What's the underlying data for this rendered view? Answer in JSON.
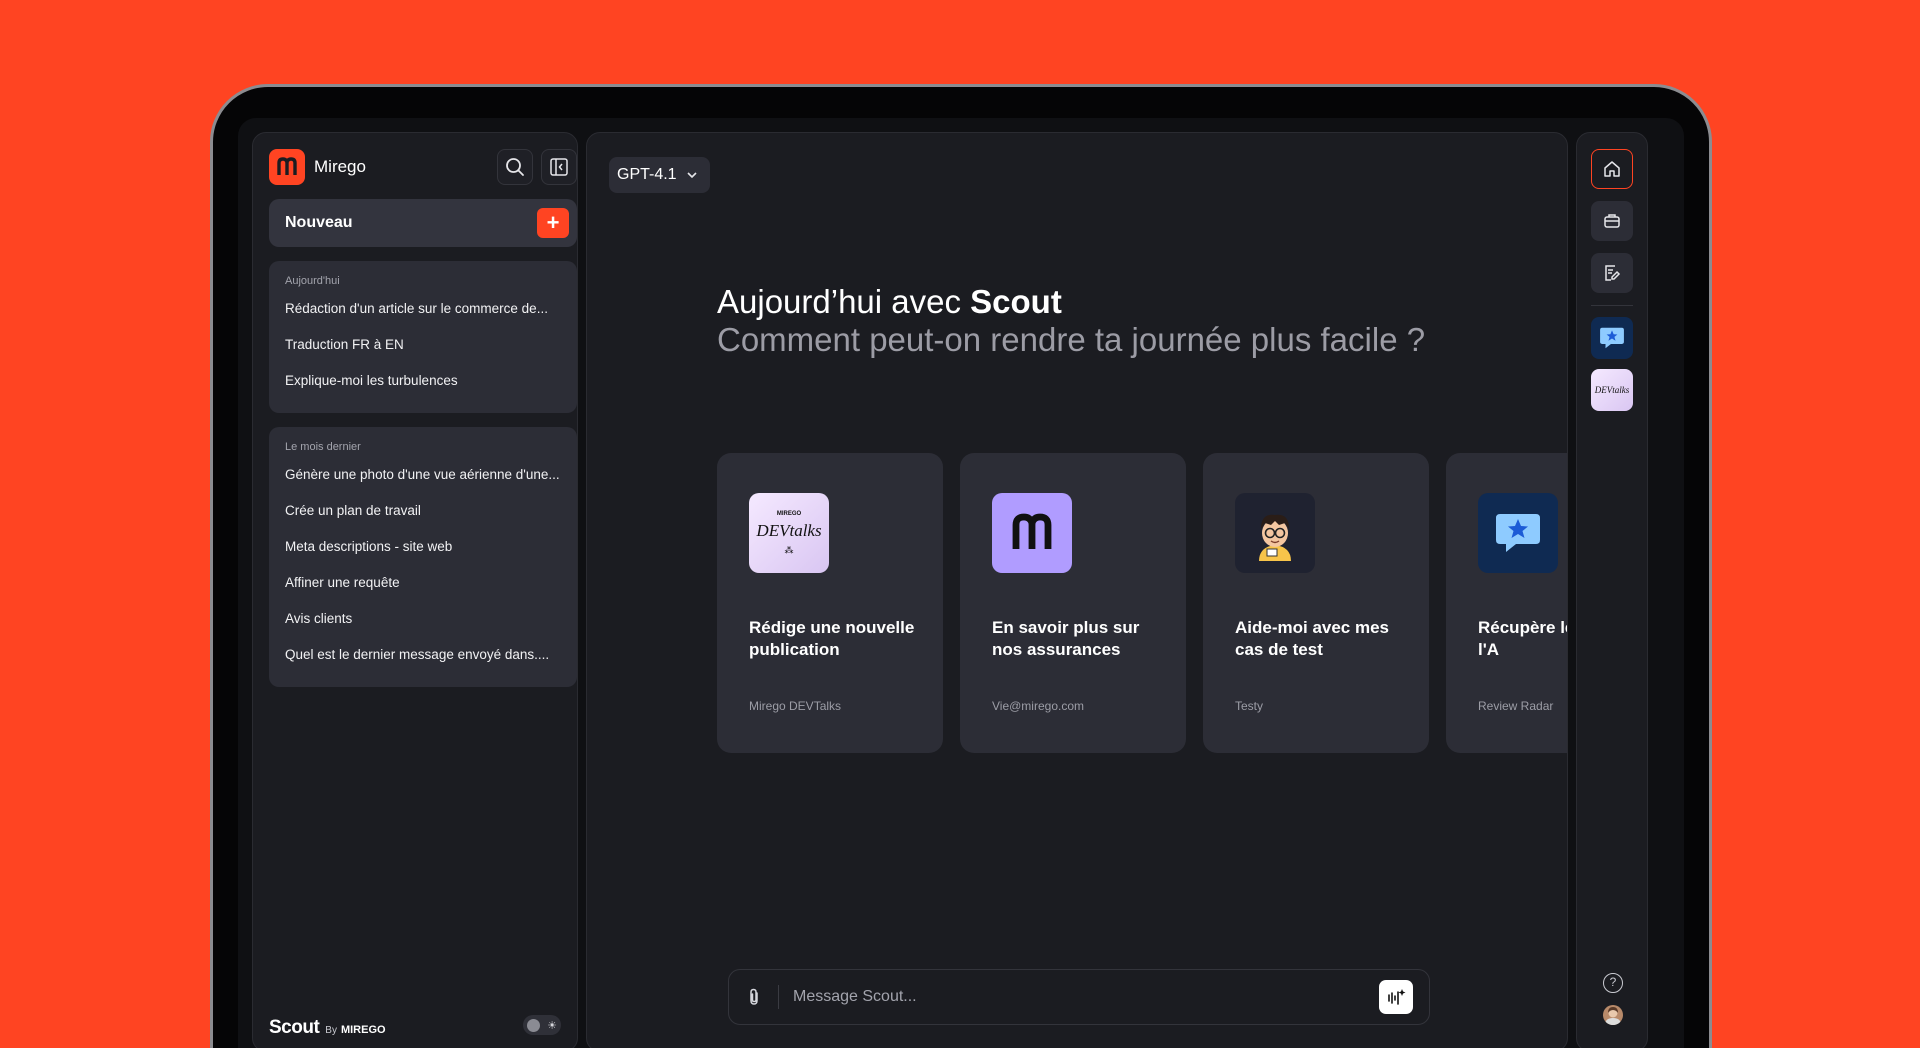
{
  "sidebar": {
    "org_name": "Mirego",
    "new_label": "Nouveau",
    "groups": [
      {
        "title": "Aujourd'hui",
        "items": [
          "Rédaction d'un article sur le commerce de...",
          "Traduction FR à EN",
          "Explique-moi les turbulences"
        ]
      },
      {
        "title": "Le mois dernier",
        "items": [
          "Génère une photo d'une vue aérienne d'une...",
          "Crée un plan de travail",
          "Meta descriptions - site web",
          "Affiner une requête",
          "Avis clients",
          "Quel est le dernier message envoyé dans...."
        ]
      }
    ],
    "footer": {
      "brand": "Scout",
      "by": "By",
      "company": "MIREGO"
    }
  },
  "main": {
    "model": "GPT-4.1",
    "greeting_prefix": "Aujourd’hui avec ",
    "greeting_name": "Scout",
    "subtitle": "Comment peut-on rendre ta journée plus facile ?",
    "cards": [
      {
        "title": "Rédige une nouvelle publication",
        "subtitle": "Mirego DEVTalks",
        "icon": "devtalks-logo"
      },
      {
        "title": "En savoir plus sur nos assurances",
        "subtitle": "Vie@mirego.com",
        "icon": "mirego-m-logo"
      },
      {
        "title": "Aide-moi avec mes cas de test",
        "subtitle": "Testy",
        "icon": "developer-avatar"
      },
      {
        "title": "Récupère le hebdo de l'A",
        "subtitle": "Review Radar",
        "icon": "star-chat-bubble"
      }
    ],
    "devtalks_small": "MIREGO",
    "devtalks_word": "DEVtalks",
    "message_placeholder": "Message Scout..."
  },
  "colors": {
    "accent": "#FF4422",
    "panel": "#1b1c21",
    "card": "#2c2d36"
  }
}
